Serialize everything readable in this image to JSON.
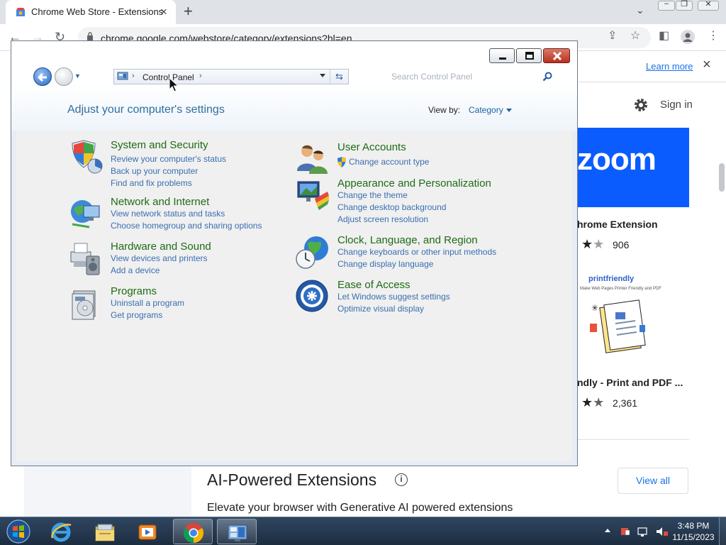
{
  "browser": {
    "tab_title": "Chrome Web Store - Extensions",
    "url": "chrome.google.com/webstore/category/extensions?hl=en",
    "learn_more": "Learn more",
    "sign_in": "Sign in"
  },
  "store": {
    "zoom_logo": "zoom",
    "ext1_name": "hrome Extension",
    "ext1_rating_count": "906",
    "print_brand": "printfriendly",
    "print_tagline": "Make Web Pages Printer Friendly and PDF",
    "ext2_name": "ndly - Print and PDF ...",
    "ext2_rating_count": "2,361",
    "section_title": "AI-Powered Extensions",
    "section_subtitle": "Elevate your browser with Generative AI powered extensions",
    "view_all": "View all",
    "info_glyph": "i"
  },
  "control_panel": {
    "address": {
      "location": "Control Panel",
      "separator": "›"
    },
    "search_placeholder": "Search Control Panel",
    "heading": "Adjust your computer's settings",
    "view_by_label": "View by:",
    "view_by_value": "Category",
    "categories_left": [
      {
        "title": "System and Security",
        "links": [
          "Review your computer's status",
          "Back up your computer",
          "Find and fix problems"
        ]
      },
      {
        "title": "Network and Internet",
        "links": [
          "View network status and tasks",
          "Choose homegroup and sharing options"
        ]
      },
      {
        "title": "Hardware and Sound",
        "links": [
          "View devices and printers",
          "Add a device"
        ]
      },
      {
        "title": "Programs",
        "links": [
          "Uninstall a program",
          "Get programs"
        ]
      }
    ],
    "categories_right": [
      {
        "title": "User Accounts",
        "links": [
          "Change account type"
        ]
      },
      {
        "title": "Appearance and Personalization",
        "links": [
          "Change the theme",
          "Change desktop background",
          "Adjust screen resolution"
        ]
      },
      {
        "title": "Clock, Language, and Region",
        "links": [
          "Change keyboards or other input methods",
          "Change display language"
        ]
      },
      {
        "title": "Ease of Access",
        "links": [
          "Let Windows suggest settings",
          "Optimize visual display"
        ]
      }
    ]
  },
  "taskbar": {
    "items": [
      "start-orb",
      "internet-explorer-icon",
      "windows-explorer-icon",
      "media-player-icon",
      "chrome-icon",
      "control-panel-icon"
    ],
    "time": "3:48 PM",
    "date": "11/15/2023"
  },
  "colors": {
    "category_title": "#1e6b14",
    "task_link": "#3a6fb0",
    "heading": "#2e6f9e",
    "zoom_blue": "#0b5cff"
  }
}
